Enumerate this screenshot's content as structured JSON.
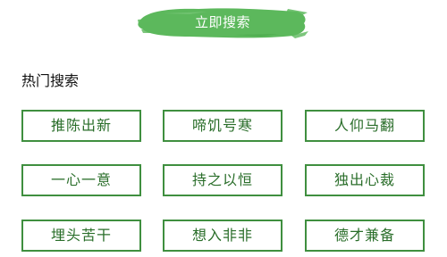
{
  "search_button": {
    "label": "立即搜索",
    "color": "#5cb85c"
  },
  "hot_search": {
    "title": "热门搜索",
    "tags": [
      "推陈出新",
      "啼饥号寒",
      "人仰马翻",
      "一心一意",
      "持之以恒",
      "独出心裁",
      "埋头苦干",
      "想入非非",
      "德才兼备"
    ]
  },
  "colors": {
    "tag_border": "#3f8f3f",
    "tag_text": "#2a6e2a"
  }
}
